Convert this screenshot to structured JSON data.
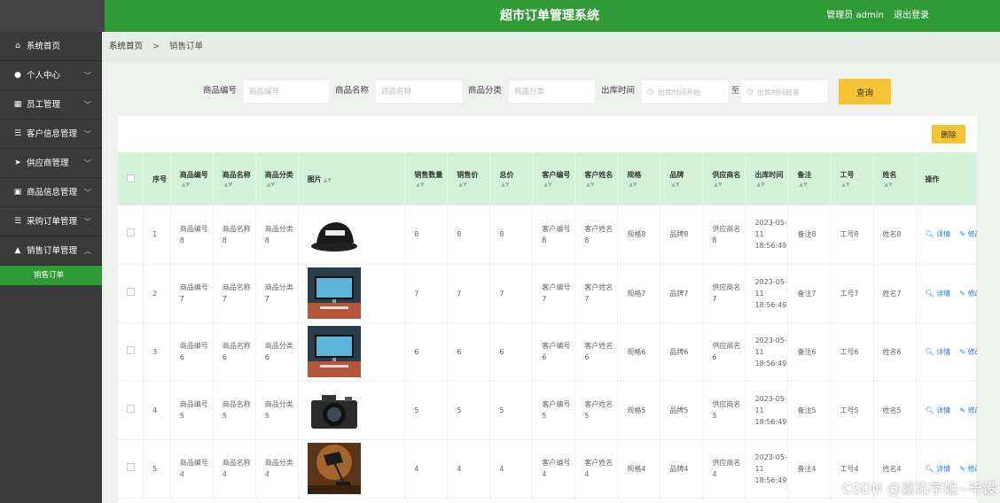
{
  "header": {
    "title": "超市订单管理系统",
    "user": "管理员 admin",
    "logout": "退出登录",
    "colors": {
      "primary": "#2f9a36",
      "sidebar": "#3a3a3a",
      "accent": "#f5c334"
    }
  },
  "sidebar": {
    "items": [
      {
        "label": "系统首页",
        "icon": "home-icon"
      },
      {
        "label": "个人中心",
        "icon": "user-icon"
      },
      {
        "label": "员工管理",
        "icon": "grid-icon"
      },
      {
        "label": "客户信息管理",
        "icon": "list-icon"
      },
      {
        "label": "供应商管理",
        "icon": "send-icon"
      },
      {
        "label": "商品信息管理",
        "icon": "clipboard-icon"
      },
      {
        "label": "采购订单管理",
        "icon": "list-icon"
      },
      {
        "label": "销售订单管理",
        "icon": "bag-icon"
      }
    ],
    "sub_item": "销售订单"
  },
  "breadcrumb": {
    "home": "系统首页",
    "current": "销售订单"
  },
  "search": {
    "code_label": "商品编号",
    "code_placeholder": "商品编号",
    "name_label": "商品名称",
    "name_placeholder": "商品名称",
    "cat_label": "商品分类",
    "cat_placeholder": "商品分类",
    "time_label": "出库时间",
    "start_placeholder": "出库时间开始",
    "range_sep": "至",
    "end_placeholder": "出库时间结束",
    "query_label": "查询"
  },
  "table": {
    "delete_label": "删除",
    "headers": [
      "序号",
      "商品编号",
      "商品名称",
      "商品分类",
      "图片",
      "销售数量",
      "销售价",
      "总价",
      "客户编号",
      "客户姓名",
      "规格",
      "品牌",
      "供应商名",
      "出库时间",
      "备注",
      "工号",
      "姓名",
      "操作"
    ],
    "detail_label": "详情",
    "edit_label": "修改",
    "rows": [
      {
        "no": "1",
        "code": "商品编号8",
        "name": "商品名称8",
        "cat": "商品分类8",
        "img": "cap",
        "qty": "8",
        "price": "8",
        "total": "8",
        "cust_no": "客户编号8",
        "cust_name": "客户姓名8",
        "spec": "规格8",
        "brand": "品牌8",
        "supplier": "供应商名8",
        "time": "2023-05-11 18:56:49",
        "remark": "备注8",
        "emp_no": "工号8",
        "emp_name": "姓名8"
      },
      {
        "no": "2",
        "code": "商品编号7",
        "name": "商品名称7",
        "cat": "商品分类7",
        "img": "monitor",
        "qty": "7",
        "price": "7",
        "total": "7",
        "cust_no": "客户编号7",
        "cust_name": "客户姓名7",
        "spec": "规格7",
        "brand": "品牌7",
        "supplier": "供应商名7",
        "time": "2023-05-11 18:56:49",
        "remark": "备注7",
        "emp_no": "工号7",
        "emp_name": "姓名7"
      },
      {
        "no": "3",
        "code": "商品编号6",
        "name": "商品名称6",
        "cat": "商品分类6",
        "img": "monitor",
        "qty": "6",
        "price": "6",
        "total": "6",
        "cust_no": "客户编号6",
        "cust_name": "客户姓名6",
        "spec": "规格6",
        "brand": "品牌6",
        "supplier": "供应商名6",
        "time": "2023-05-11 18:56:49",
        "remark": "备注6",
        "emp_no": "工号6",
        "emp_name": "姓名6"
      },
      {
        "no": "4",
        "code": "商品编号5",
        "name": "商品名称5",
        "cat": "商品分类5",
        "img": "camera",
        "qty": "5",
        "price": "5",
        "total": "5",
        "cust_no": "客户编号5",
        "cust_name": "客户姓名5",
        "spec": "规格5",
        "brand": "品牌5",
        "supplier": "供应商名5",
        "time": "2023-05-11 18:56:49",
        "remark": "备注5",
        "emp_no": "工号5",
        "emp_name": "姓名5"
      },
      {
        "no": "5",
        "code": "商品编号4",
        "name": "商品名称4",
        "cat": "商品分类4",
        "img": "lamp",
        "qty": "4",
        "price": "4",
        "total": "4",
        "cust_no": "客户编号4",
        "cust_name": "客户姓名4",
        "spec": "规格4",
        "brand": "品牌4",
        "supplier": "供应商名4",
        "time": "2023-05-11 18:56:49",
        "remark": "备注4",
        "emp_no": "工号4",
        "emp_name": "姓名4"
      }
    ]
  },
  "watermark": "CSDN @嘉佑学姐--毕设"
}
